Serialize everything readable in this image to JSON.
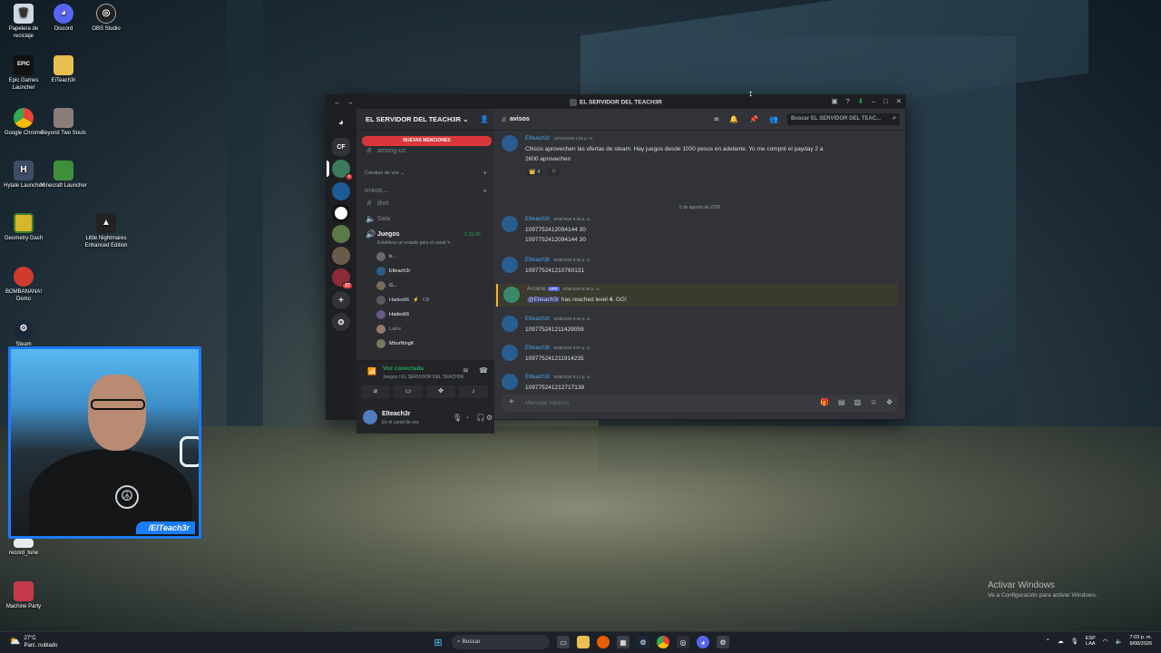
{
  "desktop": {
    "icons": [
      {
        "label": "Papelera de reciclaje",
        "icon": "recycle-bin-icon"
      },
      {
        "label": "Discord",
        "icon": "discord-icon"
      },
      {
        "label": "OBS Studio",
        "icon": "obs-icon"
      },
      {
        "label": "Epic Games Launcher",
        "icon": "epic-icon"
      },
      {
        "label": "ElTeach3r",
        "icon": "folder-icon"
      },
      {
        "label": "Google Chrome",
        "icon": "chrome-icon"
      },
      {
        "label": "Beyond Two Souls",
        "icon": "game-icon"
      },
      {
        "label": "Hytale Launcher",
        "icon": "hytale-icon"
      },
      {
        "label": "Minecraft Launcher",
        "icon": "minecraft-icon"
      },
      {
        "label": "Geometry Dash",
        "icon": "geometry-dash-icon"
      },
      {
        "label": "Little Nightmares Enhanced Edition",
        "icon": "little-nightmares-icon"
      },
      {
        "label": "BOMBANANA! Demo",
        "icon": "bombanana-icon"
      },
      {
        "label": "Steam",
        "icon": "steam-icon"
      },
      {
        "label": "record_tune",
        "icon": "record-icon"
      },
      {
        "label": "Machine Party",
        "icon": "machine-party-icon"
      }
    ]
  },
  "webcam": {
    "handle": "/ElTeach3r"
  },
  "discord": {
    "window_title": "EL SERVIDOR DEL TEACH3R",
    "guilds": [
      "CF"
    ],
    "server_name": "EL SERVIDOR DEL TEACH3R",
    "new_mentions": "NUEVAS MENCIONES",
    "channels": {
      "among_us": "among-us",
      "voice_category": "Canales de voz",
      "others_category": "OTROS",
      "dixit": "dixit",
      "sala": "Sala",
      "juegos": "Juegos",
      "juegos_time": "1:11:05",
      "juegos_status": "Establece un estado para el canal"
    },
    "voice_users": [
      {
        "name": "b..."
      },
      {
        "name": "Elteach3r"
      },
      {
        "name": "G..."
      },
      {
        "name": "Hades66",
        "extra": "CB"
      },
      {
        "name": "Hades66"
      },
      {
        "name": "Lalox"
      },
      {
        "name": "MburNingK"
      }
    ],
    "voice_panel": {
      "title": "Voz conectada",
      "sub": "Juegos / EL SERVIDOR DEL TEACH3R"
    },
    "user": {
      "name": "Elteach3r",
      "status": "En el canal de voz"
    },
    "chat": {
      "channel": "avisos",
      "search_placeholder": "Buscar EL SERVIDOR DEL TEAC...",
      "date_divider": "5 de agosto de 2026",
      "composer_placeholder": "Mensaje #avisos",
      "messages": [
        {
          "author": "Elteach3r",
          "time": "19/12/2025 1:02 p. m.",
          "lines": [
            "Chicos aprovechen las ofertas de steam. Hay juegos desde 1000 pesos en adelante. Yo me compré el payday 2 a",
            "2600 aprovechen"
          ],
          "reaction": "4"
        },
        {
          "author": "Elteach3r",
          "time": "5/08/2026 8:28 p. m.",
          "lines": [
            "1097752412094144 30",
            "1097752412094144 30"
          ]
        },
        {
          "author": "Elteach3r",
          "time": "5/08/2026 8:38 p. m.",
          "lines": [
            "109775241210760131"
          ]
        },
        {
          "author": "Arcane",
          "tag": "APP",
          "time": "5/08/2026 8:38 p. m.",
          "mention": "@Elteach3r",
          "text": "has reached level",
          "level": "4",
          "suffix": ". GG!"
        },
        {
          "author": "Elteach3r",
          "time": "5/08/2026 8:49 p. m.",
          "lines": [
            "109775241211429059"
          ]
        },
        {
          "author": "Elteach3r",
          "time": "5/08/2026 8:57 p. m.",
          "lines": [
            "109775241211914235"
          ]
        },
        {
          "author": "Elteach3r",
          "time": "5/08/2026 9:12 p. m.",
          "lines": [
            "109775241212717138"
          ]
        }
      ]
    }
  },
  "taskbar": {
    "weather_temp": "27°C",
    "weather_desc": "Parc. nublado",
    "search": "Buscar",
    "lang_top": "ESP",
    "lang_bottom": "LAA",
    "time": "7:03 p. m.",
    "date": "8/08/2026"
  },
  "watermark": {
    "title": "Activar Windows",
    "sub": "Ve a Configuración para activar Windows."
  },
  "colors": {
    "discord_bg": "#313338",
    "accent": "#5865f2",
    "mention_red": "#da373c",
    "online": "#23a55a"
  }
}
